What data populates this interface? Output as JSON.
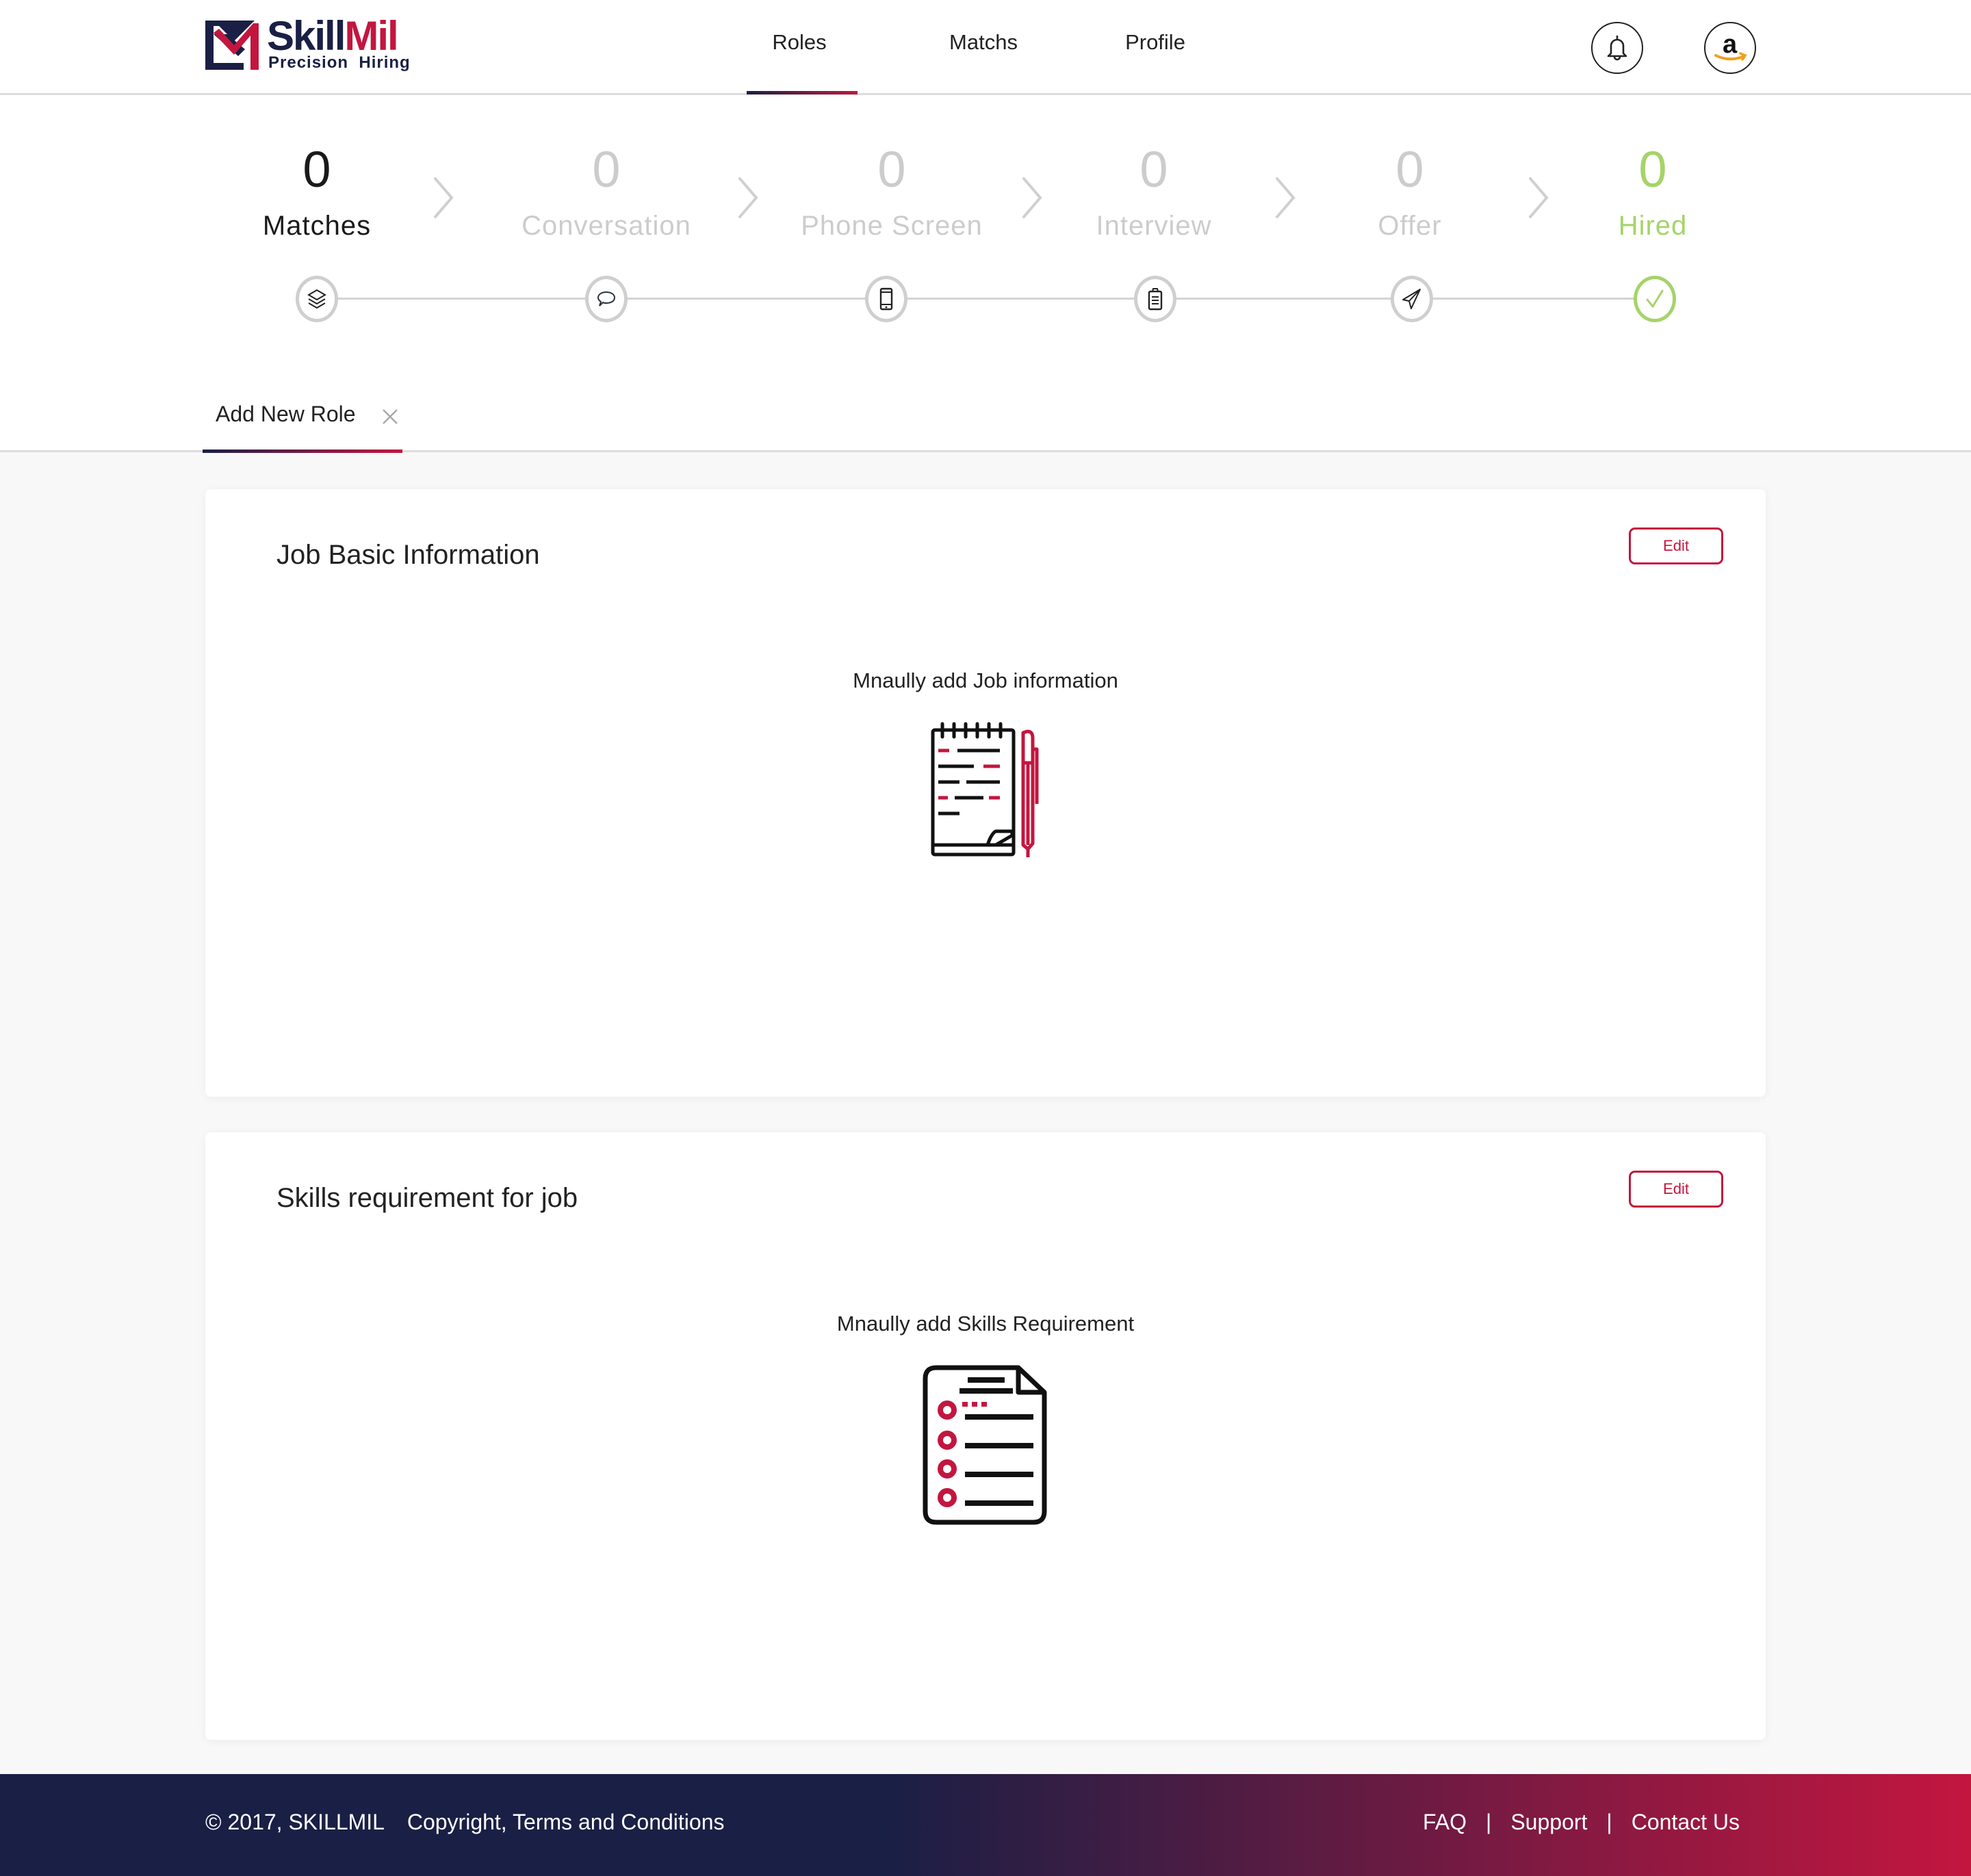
{
  "header": {
    "logo": {
      "name_part1": "Skill",
      "name_part2": "Mil",
      "tagline": "Precision  Hiring"
    },
    "nav": [
      {
        "label": "Roles",
        "active": true
      },
      {
        "label": "Matchs",
        "active": false
      },
      {
        "label": "Profile",
        "active": false
      }
    ],
    "notifications_icon": "bell-icon",
    "account_icon": "amazon-logo"
  },
  "pipeline": {
    "steps": [
      {
        "label": "Matches",
        "count": "0",
        "icon": "layers-icon",
        "state": "active"
      },
      {
        "label": "Conversation",
        "count": "0",
        "icon": "chat-bubble-icon",
        "state": "inactive"
      },
      {
        "label": "Phone Screen",
        "count": "0",
        "icon": "mobile-phone-icon",
        "state": "inactive"
      },
      {
        "label": "Interview",
        "count": "0",
        "icon": "clipboard-icon",
        "state": "inactive"
      },
      {
        "label": "Offer",
        "count": "0",
        "icon": "paper-plane-icon",
        "state": "inactive"
      },
      {
        "label": "Hired",
        "count": "0",
        "icon": "checkmark-icon",
        "state": "done"
      }
    ]
  },
  "tabs": [
    {
      "label": "Add New Role",
      "closable": true,
      "active": true
    }
  ],
  "cards": [
    {
      "title": "Job Basic Information",
      "edit_label": "Edit",
      "hint": "Mnaully add Job information",
      "illustration": "notepad-pen-icon"
    },
    {
      "title": "Skills requirement for job",
      "edit_label": "Edit",
      "hint": "Mnaully add Skills Requirement",
      "illustration": "checklist-document-icon"
    }
  ],
  "footer": {
    "copyright": "© 2017, SKILLMIL",
    "terms_link": "Copyright, Terms and Conditions",
    "links": [
      "FAQ",
      "Support",
      "Contact Us"
    ],
    "separator": "|"
  },
  "colors": {
    "brand_navy": "#1a1f45",
    "brand_red": "#c3163f",
    "success_green": "#a6d36a",
    "inactive_gray": "#cccccc"
  }
}
